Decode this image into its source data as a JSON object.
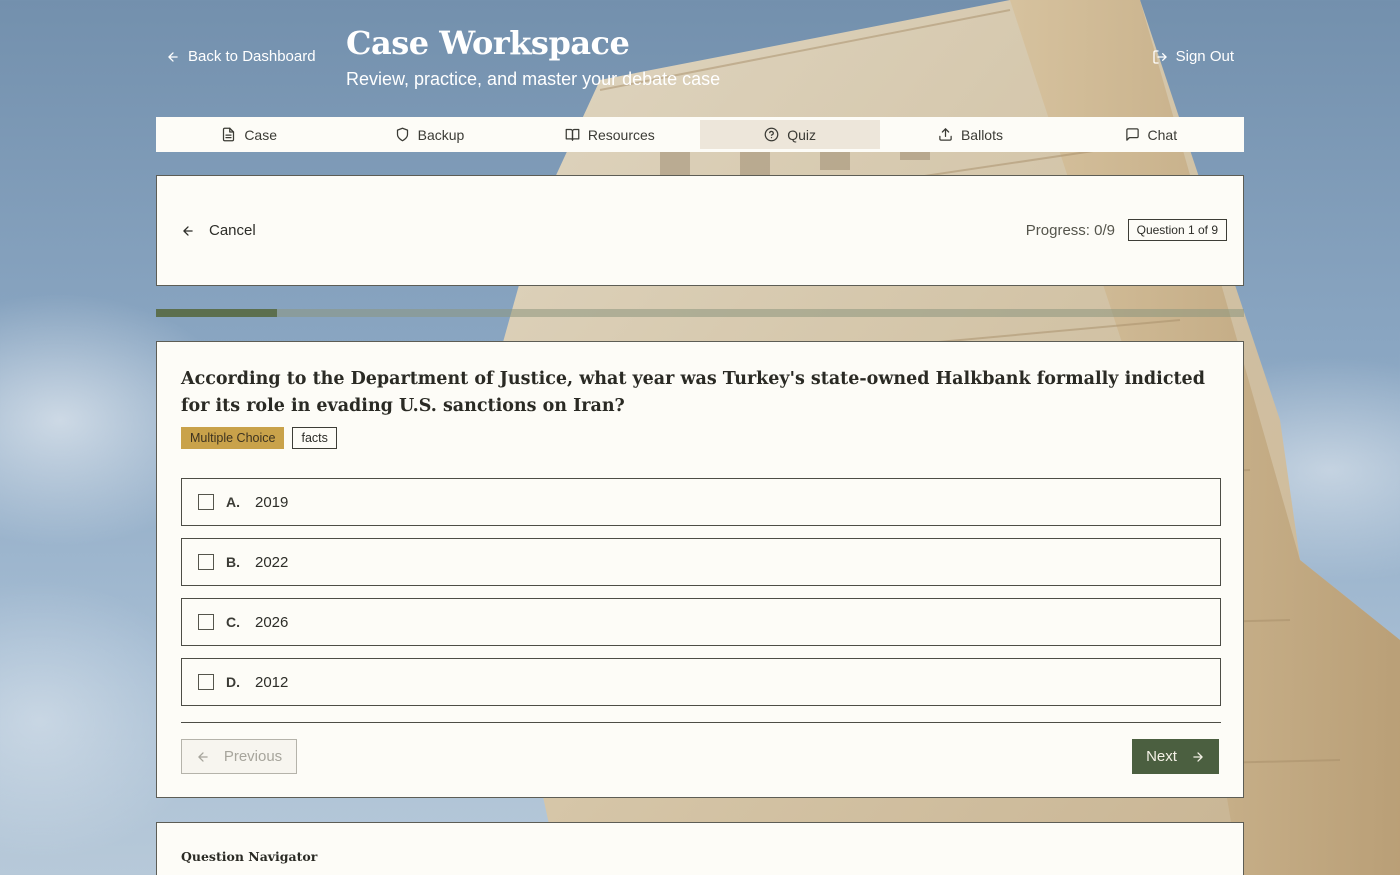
{
  "header": {
    "back_label": "Back to Dashboard",
    "title": "Case Workspace",
    "subtitle": "Review, practice, and master your debate case",
    "signout_label": "Sign Out"
  },
  "tabs": [
    {
      "label": "Case",
      "icon": "file-icon"
    },
    {
      "label": "Backup",
      "icon": "shield-icon"
    },
    {
      "label": "Resources",
      "icon": "book-icon"
    },
    {
      "label": "Quiz",
      "icon": "question-circle-icon",
      "active": true
    },
    {
      "label": "Ballots",
      "icon": "upload-icon"
    },
    {
      "label": "Chat",
      "icon": "chat-icon"
    }
  ],
  "quiz_header": {
    "cancel_label": "Cancel",
    "progress_text": "Progress: 0/9",
    "question_badge": "Question 1 of 9",
    "progress_fraction": 0.111
  },
  "question": {
    "text": "According to the Department of Justice, what year was Turkey's state-owned Halkbank formally indicted for its role in evading U.S. sanctions on Iran?",
    "type_tag": "Multiple Choice",
    "category_tag": "facts",
    "options": [
      {
        "letter": "A.",
        "text": "2019"
      },
      {
        "letter": "B.",
        "text": "2022"
      },
      {
        "letter": "C.",
        "text": "2026"
      },
      {
        "letter": "D.",
        "text": "2012"
      }
    ],
    "previous_label": "Previous",
    "next_label": "Next"
  },
  "navigator": {
    "title": "Question Navigator"
  },
  "colors": {
    "accent_green": "#4b5f40",
    "tag_gold": "#c9a24a",
    "card_bg": "#fdfcf7"
  }
}
